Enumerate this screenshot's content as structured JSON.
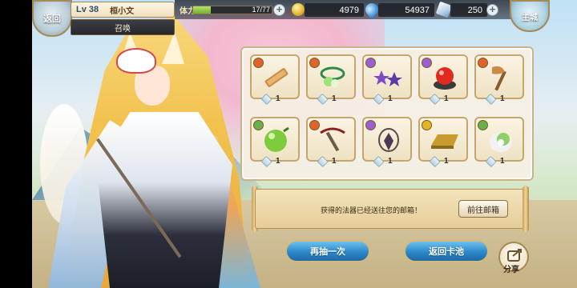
{
  "header": {
    "back_label": "返回",
    "level": "Lv 38",
    "player_name": "桓小文",
    "tab": "召唤",
    "main_label": "主城",
    "stamina_label": "体力",
    "stamina_text": "17/77",
    "stamina_fraction": 0.22
  },
  "currencies": [
    {
      "icon": "gold-coin-icon",
      "value": "4979"
    },
    {
      "icon": "blue-gem-icon",
      "value": "54937"
    },
    {
      "icon": "crystal-icon",
      "value": "250"
    }
  ],
  "rewards": {
    "items": [
      {
        "icon": "wooden-scroll-icon",
        "qty": "1",
        "gem_color": "#e0632b"
      },
      {
        "icon": "jade-necklace-icon",
        "qty": "1",
        "gem_color": "#e0632b"
      },
      {
        "icon": "purple-stars-icon",
        "qty": "1",
        "gem_color": "#9b5fd0"
      },
      {
        "icon": "red-orb-icon",
        "qty": "1",
        "gem_color": "#9b5fd0"
      },
      {
        "icon": "axe-icon",
        "qty": "1",
        "gem_color": "#e0632b"
      },
      {
        "icon": "green-orb-icon",
        "qty": "1",
        "gem_color": "#6ab04c"
      },
      {
        "icon": "crossbow-icon",
        "qty": "1",
        "gem_color": "#e0632b"
      },
      {
        "icon": "amulet-icon",
        "qty": "1",
        "gem_color": "#9b5fd0"
      },
      {
        "icon": "gold-bar-icon",
        "qty": "1",
        "gem_color": "#e6b422"
      },
      {
        "icon": "spirit-pet-icon",
        "qty": "1",
        "gem_color": "#6ab04c"
      }
    ]
  },
  "message": {
    "text": "获得的法器已经送往您的邮箱！",
    "mail_button": "前往邮箱"
  },
  "actions": {
    "draw_again": "再抽一次",
    "return_pool": "返回卡池",
    "share": "分享"
  },
  "colors": {
    "panel_border": "#c9b48a",
    "button_blue": "#2c87c8",
    "stamina_green": "#72b42e"
  }
}
